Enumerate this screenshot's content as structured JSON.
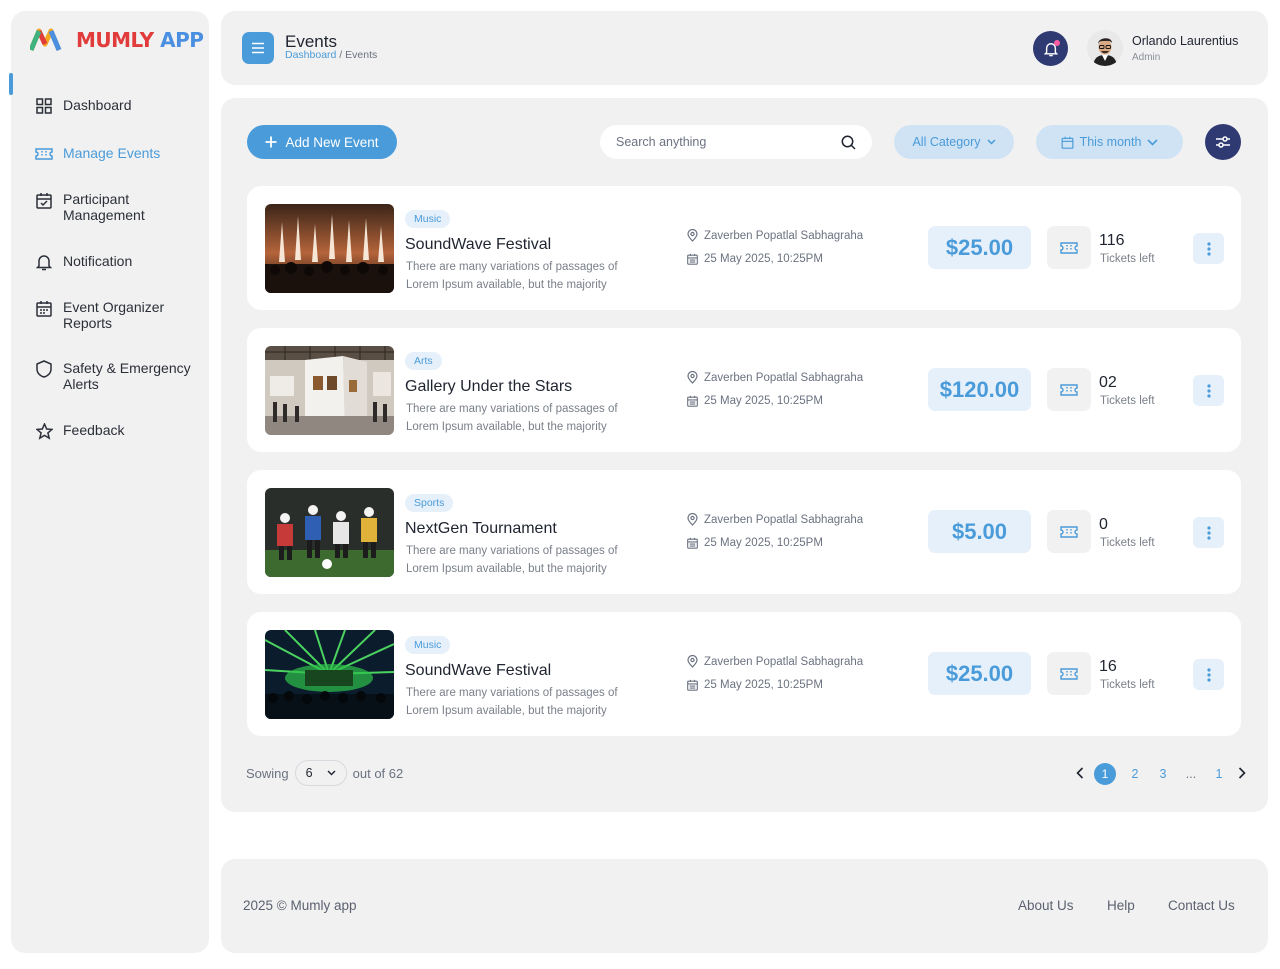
{
  "brand": {
    "logo_text": "MUMLY",
    "logo_app": "APP",
    "accent": "#4a9bd9",
    "dark": "#2f3a73"
  },
  "sidebar": {
    "items": [
      {
        "label": "Dashboard",
        "icon": "grid-icon"
      },
      {
        "label": "Manage Events",
        "icon": "ticket-icon",
        "active": true
      },
      {
        "label": "Participant Management",
        "icon": "calendar-check-icon"
      },
      {
        "label": "Notification",
        "icon": "bell-icon"
      },
      {
        "label": "Event Organizer Reports",
        "icon": "calendar-report-icon"
      },
      {
        "label": "Safety & Emergency Alerts",
        "icon": "shield-icon"
      },
      {
        "label": "Feedback",
        "icon": "star-icon"
      }
    ]
  },
  "header": {
    "title": "Events",
    "breadcrumb_root": "Dashboard",
    "breadcrumb_sep": " / ",
    "breadcrumb_current": "Events",
    "user_name": "Orlando Laurentius",
    "user_role": "Admin"
  },
  "toolbar": {
    "add_label": "Add New Event",
    "search_placeholder": "Search anything",
    "category_label": "All Category",
    "period_label": "This month"
  },
  "events": [
    {
      "tag": "Music",
      "title": "SoundWave Festival",
      "desc": "There are many variations of passages of Lorem Ipsum available, but the majority",
      "location": "Zaverben Popatlal Sabhagraha",
      "date": "25 May 2025, 10:25PM",
      "price": "$25.00",
      "tickets": "116",
      "tickets_label": "Tickets left"
    },
    {
      "tag": "Arts",
      "title": "Gallery Under the Stars",
      "desc": "There are many variations of passages of Lorem Ipsum available, but the majority",
      "location": "Zaverben Popatlal Sabhagraha",
      "date": "25 May 2025, 10:25PM",
      "price": "$120.00",
      "tickets": "02",
      "tickets_label": "Tickets left"
    },
    {
      "tag": "Sports",
      "title": "NextGen Tournament",
      "desc": "There are many variations of passages of Lorem Ipsum available, but the majority",
      "location": "Zaverben Popatlal Sabhagraha",
      "date": "25 May 2025, 10:25PM",
      "price": "$5.00",
      "tickets": "0",
      "tickets_label": "Tickets left"
    },
    {
      "tag": "Music",
      "title": "SoundWave Festival",
      "desc": "There are many variations of passages of Lorem Ipsum available, but the majority",
      "location": "Zaverben Popatlal Sabhagraha",
      "date": "25 May 2025, 10:25PM",
      "price": "$25.00",
      "tickets": "16",
      "tickets_label": "Tickets left"
    }
  ],
  "pagination": {
    "showing_label": "Sowing",
    "per_page": "6",
    "out_of": "out of 62",
    "pages": [
      "1",
      "2",
      "3",
      "...",
      "1"
    ],
    "current": "1"
  },
  "footer": {
    "copyright": "2025 © Mumly app",
    "links": [
      "About Us",
      "Help",
      "Contact Us"
    ]
  }
}
